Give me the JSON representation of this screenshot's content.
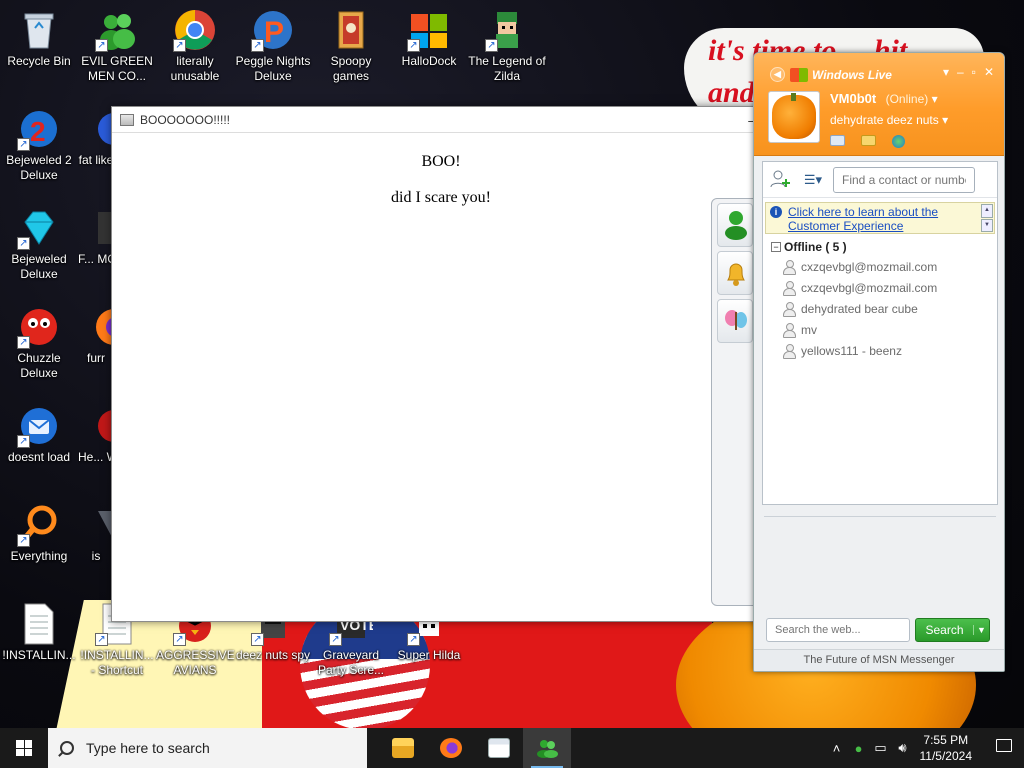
{
  "desktop": {
    "icons": [
      {
        "label": "Recycle Bin",
        "icon": "recycle-bin-icon"
      },
      {
        "label": "EVIL GREEN MEN CO...",
        "icon": "msn-buddies-icon"
      },
      {
        "label": "literally unusable",
        "icon": "chrome-icon"
      },
      {
        "label": "Peggle Nights Deluxe",
        "icon": "peggle-icon"
      },
      {
        "label": "Spoopy games",
        "icon": "folder-games-icon"
      },
      {
        "label": "HalloDock",
        "icon": "windows-logo-icon"
      },
      {
        "label": "The Legend of Zilda",
        "icon": "zelda-character-icon"
      },
      {
        "label": "Bejeweled 2 Deluxe",
        "icon": "bejeweled-2-icon"
      },
      {
        "label": "fat like",
        "icon": "app-icon"
      },
      {
        "label": "Bejeweled Deluxe",
        "icon": "diamond-icon"
      },
      {
        "label": "F... MON...",
        "icon": "app-icon"
      },
      {
        "label": "Chuzzle Deluxe",
        "icon": "chuzzle-icon"
      },
      {
        "label": "furr",
        "icon": "firefox-icon"
      },
      {
        "label": "doesnt load",
        "icon": "thunderbird-icon"
      },
      {
        "label": "He... We...",
        "icon": "app-icon"
      },
      {
        "label": "Everything",
        "icon": "everything-search-icon"
      },
      {
        "label": "is",
        "icon": "app-icon"
      },
      {
        "label": "!INSTALLIN...",
        "icon": "document-icon"
      },
      {
        "label": "!INSTALLIN... - Shortcut",
        "icon": "document-icon"
      },
      {
        "label": "AGGRESSIVE AVIANS",
        "icon": "angry-bird-icon"
      },
      {
        "label": "deez nuts spy",
        "icon": "spy-icon"
      },
      {
        "label": "Graveyard Party Scre...",
        "icon": "graveyard-icon"
      },
      {
        "label": "Super Hilda",
        "icon": "pixel-character-icon"
      }
    ],
    "wallpaper_text_1": "it's time to ... hit",
    "wallpaper_text_2": "and",
    "vote_text": "VOTE"
  },
  "boo_window": {
    "title": "BOOOOOOO!!!!!",
    "heading": "BOO!",
    "body": "did I scare you!"
  },
  "messenger": {
    "brand": "Windows Live",
    "display_name": "VM0b0t",
    "status": "(Online)",
    "personal_message": "dehydrate deez nuts",
    "search_placeholder": "Find a contact or number",
    "info_link": "Click here to learn about the Customer Experience",
    "group": {
      "name": "Offline ( 5 )",
      "contacts": [
        "cxzqevbgl@mozmail.com",
        "cxzqevbgl@mozmail.com",
        "dehydrated bear cube",
        "mv",
        "yellows111 - beenz"
      ]
    },
    "web_search_placeholder": "Search the web...",
    "search_button": "Search",
    "footer": "The Future of MSN Messenger",
    "accent_color": "#f7931e"
  },
  "taskbar": {
    "search_text": "Type here to search",
    "apps": [
      "file-explorer-icon",
      "firefox-icon",
      "window-app-icon",
      "msn-messenger-icon"
    ],
    "time": "7:55 PM",
    "date": "11/5/2024"
  }
}
